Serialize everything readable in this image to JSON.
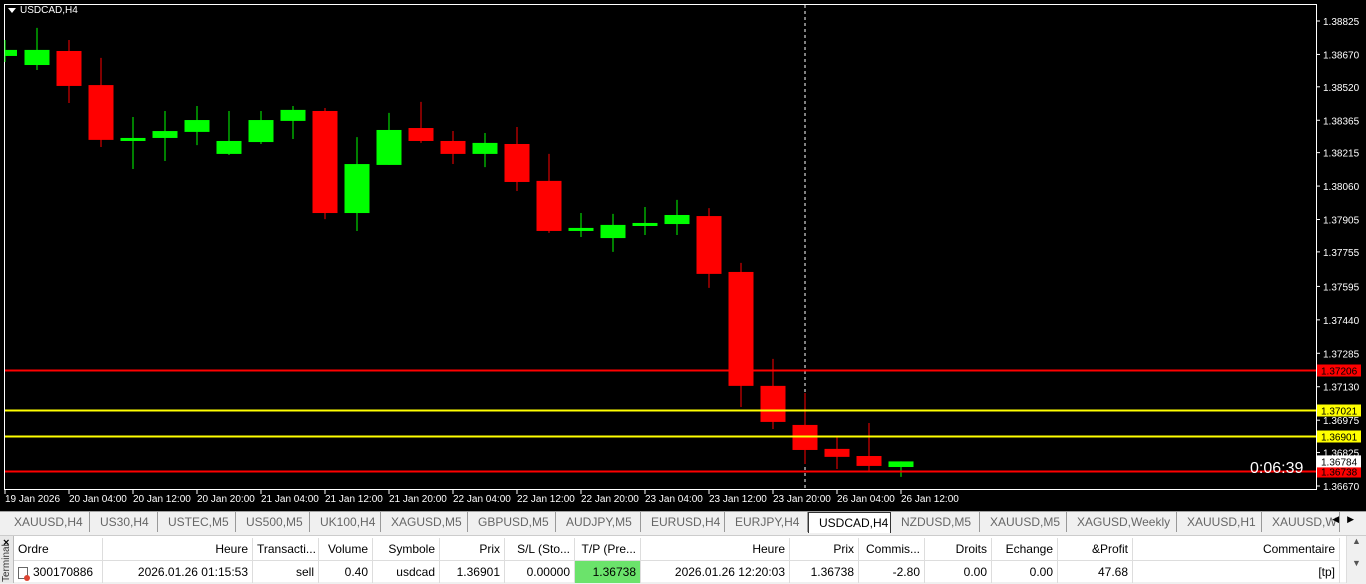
{
  "chart_title": "USDCAD,H4",
  "timer": "0:06:39",
  "colors": {
    "bull": "#00ff00",
    "bear": "#ff0000",
    "background": "#000000",
    "tp_line": "#ff0000",
    "level_line": "#ffff00",
    "tp_cell": "#6be36b"
  },
  "chart_data": {
    "type": "candlestick",
    "symbol": "USDCAD",
    "timeframe": "H4",
    "ylim": [
      1.3664,
      1.3884
    ],
    "y_ticks": [
      "1.38825",
      "1.38670",
      "1.38520",
      "1.38365",
      "1.38215",
      "1.38060",
      "1.37905",
      "1.37755",
      "1.37595",
      "1.37440",
      "1.37285",
      "1.37130",
      "1.36975",
      "1.36825",
      "1.36670"
    ],
    "x_labels": [
      {
        "bar": 0,
        "text": "19 Jan 2026"
      },
      {
        "bar": 2,
        "text": "20 Jan 04:00"
      },
      {
        "bar": 4,
        "text": "20 Jan 12:00"
      },
      {
        "bar": 6,
        "text": "20 Jan 20:00"
      },
      {
        "bar": 8,
        "text": "21 Jan 04:00"
      },
      {
        "bar": 10,
        "text": "21 Jan 12:00"
      },
      {
        "bar": 12,
        "text": "21 Jan 20:00"
      },
      {
        "bar": 14,
        "text": "22 Jan 04:00"
      },
      {
        "bar": 16,
        "text": "22 Jan 12:00"
      },
      {
        "bar": 18,
        "text": "22 Jan 20:00"
      },
      {
        "bar": 20,
        "text": "23 Jan 04:00"
      },
      {
        "bar": 22,
        "text": "23 Jan 12:00"
      },
      {
        "bar": 24,
        "text": "23 Jan 20:00"
      },
      {
        "bar": 26,
        "text": "26 Jan 04:00"
      },
      {
        "bar": 28,
        "text": "26 Jan 12:00"
      }
    ],
    "ohlc": [
      [
        1.38663,
        1.38737,
        1.38635,
        1.38691
      ],
      [
        1.38621,
        1.38793,
        1.38598,
        1.38691
      ],
      [
        1.38686,
        1.38737,
        1.38445,
        1.38524
      ],
      [
        1.38528,
        1.38654,
        1.38241,
        1.38274
      ],
      [
        1.38269,
        1.3838,
        1.38139,
        1.38283
      ],
      [
        1.38283,
        1.38408,
        1.38176,
        1.38315
      ],
      [
        1.38311,
        1.38431,
        1.3825,
        1.38366
      ],
      [
        1.38209,
        1.38408,
        1.38204,
        1.38269
      ],
      [
        1.38264,
        1.38408,
        1.38255,
        1.38366
      ],
      [
        1.38362,
        1.38431,
        1.38278,
        1.38413
      ],
      [
        1.38408,
        1.38422,
        1.37907,
        1.37935
      ],
      [
        1.37935,
        1.38287,
        1.37852,
        1.38162
      ],
      [
        1.38158,
        1.38399,
        1.38158,
        1.3832
      ],
      [
        1.38329,
        1.3845,
        1.3826,
        1.38269
      ],
      [
        1.38269,
        1.38315,
        1.38162,
        1.38209
      ],
      [
        1.38209,
        1.38306,
        1.38148,
        1.3826
      ],
      [
        1.38255,
        1.38334,
        1.38037,
        1.38079
      ],
      [
        1.38084,
        1.38209,
        1.37843,
        1.37852
      ],
      [
        1.37852,
        1.37935,
        1.37824,
        1.37866
      ],
      [
        1.37819,
        1.37931,
        1.37755,
        1.3788
      ],
      [
        1.37875,
        1.37963,
        1.37833,
        1.37889
      ],
      [
        1.37884,
        1.37996,
        1.37833,
        1.37926
      ],
      [
        1.37921,
        1.37958,
        1.37588,
        1.37653
      ],
      [
        1.37662,
        1.37704,
        1.37036,
        1.37134
      ],
      [
        1.37134,
        1.37259,
        1.36934,
        1.36967
      ],
      [
        1.36953,
        1.37101,
        1.36772,
        1.36837
      ],
      [
        1.36842,
        1.36897,
        1.36749,
        1.36805
      ],
      [
        1.36809,
        1.36962,
        1.3674,
        1.36763
      ],
      [
        1.36758,
        1.36784,
        1.36712,
        1.36784
      ]
    ],
    "separator_bar": 25,
    "hlines": [
      {
        "price": "1.37206",
        "color": "#ff0000",
        "label_bg": "#ff0000",
        "label_fg": "#000000"
      },
      {
        "price": "1.37021",
        "color": "#ffff00",
        "label_bg": "#ffff00",
        "label_fg": "#000000"
      },
      {
        "price": "1.36901",
        "color": "#ffff00",
        "label_bg": "#ffff00",
        "label_fg": "#000000"
      },
      {
        "price": "1.36738",
        "color": "#ff0000",
        "label_bg": "#ff0000",
        "label_fg": "#000000"
      }
    ],
    "bid": "1.36784"
  },
  "tabs": [
    "XAUUSD,H4",
    "US30,H4",
    "USTEC,M5",
    "US500,M5",
    "UK100,H4",
    "XAGUSD,M5",
    "GBPUSD,M5",
    "AUDJPY,M5",
    "EURUSD,H4",
    "EURJPY,H4",
    "USDCAD,H4",
    "NZDUSD,M5",
    "XAUUSD,M5",
    "XAGUSD,Weekly",
    "XAUUSD,H1",
    "XAUUSD,W"
  ],
  "active_tab": "USDCAD,H4",
  "terminal": {
    "side_label": "Terminal",
    "close": "×",
    "columns": [
      "Ordre",
      "Heure",
      "Transacti...",
      "Volume",
      "Symbole",
      "Prix",
      "S/L (Sto...",
      "T/P (Pre...",
      "Heure",
      "Prix",
      "Commis...",
      "Droits",
      "Echange",
      "&Profit",
      "Commentaire"
    ],
    "rows": [
      [
        "300170886",
        "2026.01.26 01:15:53",
        "sell",
        "0.40",
        "usdcad",
        "1.36901",
        "0.00000",
        "1.36738",
        "2026.01.26 12:20:03",
        "1.36738",
        "-2.80",
        "0.00",
        "0.00",
        "47.68",
        "[tp]"
      ]
    ]
  }
}
